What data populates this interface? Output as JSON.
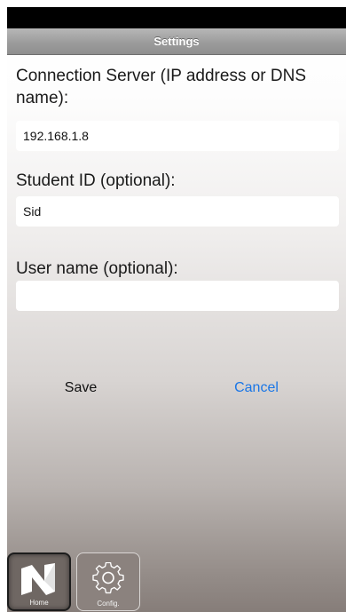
{
  "header": {
    "title": "Settings"
  },
  "form": {
    "server": {
      "label": "Connection Server (IP address or DNS name):",
      "value": "192.168.1.8"
    },
    "student_id": {
      "label": "Student ID (optional):",
      "value": "Sid"
    },
    "user_name": {
      "label": "User name (optional):",
      "value": ""
    }
  },
  "actions": {
    "save_label": "Save",
    "cancel_label": "Cancel"
  },
  "tabs": [
    {
      "label": "Home",
      "icon": "n-logo-icon",
      "selected": true
    },
    {
      "label": "Config.",
      "icon": "gear-icon",
      "selected": false
    }
  ],
  "colors": {
    "link": "#1a76e6",
    "status_bar": "#000000"
  }
}
